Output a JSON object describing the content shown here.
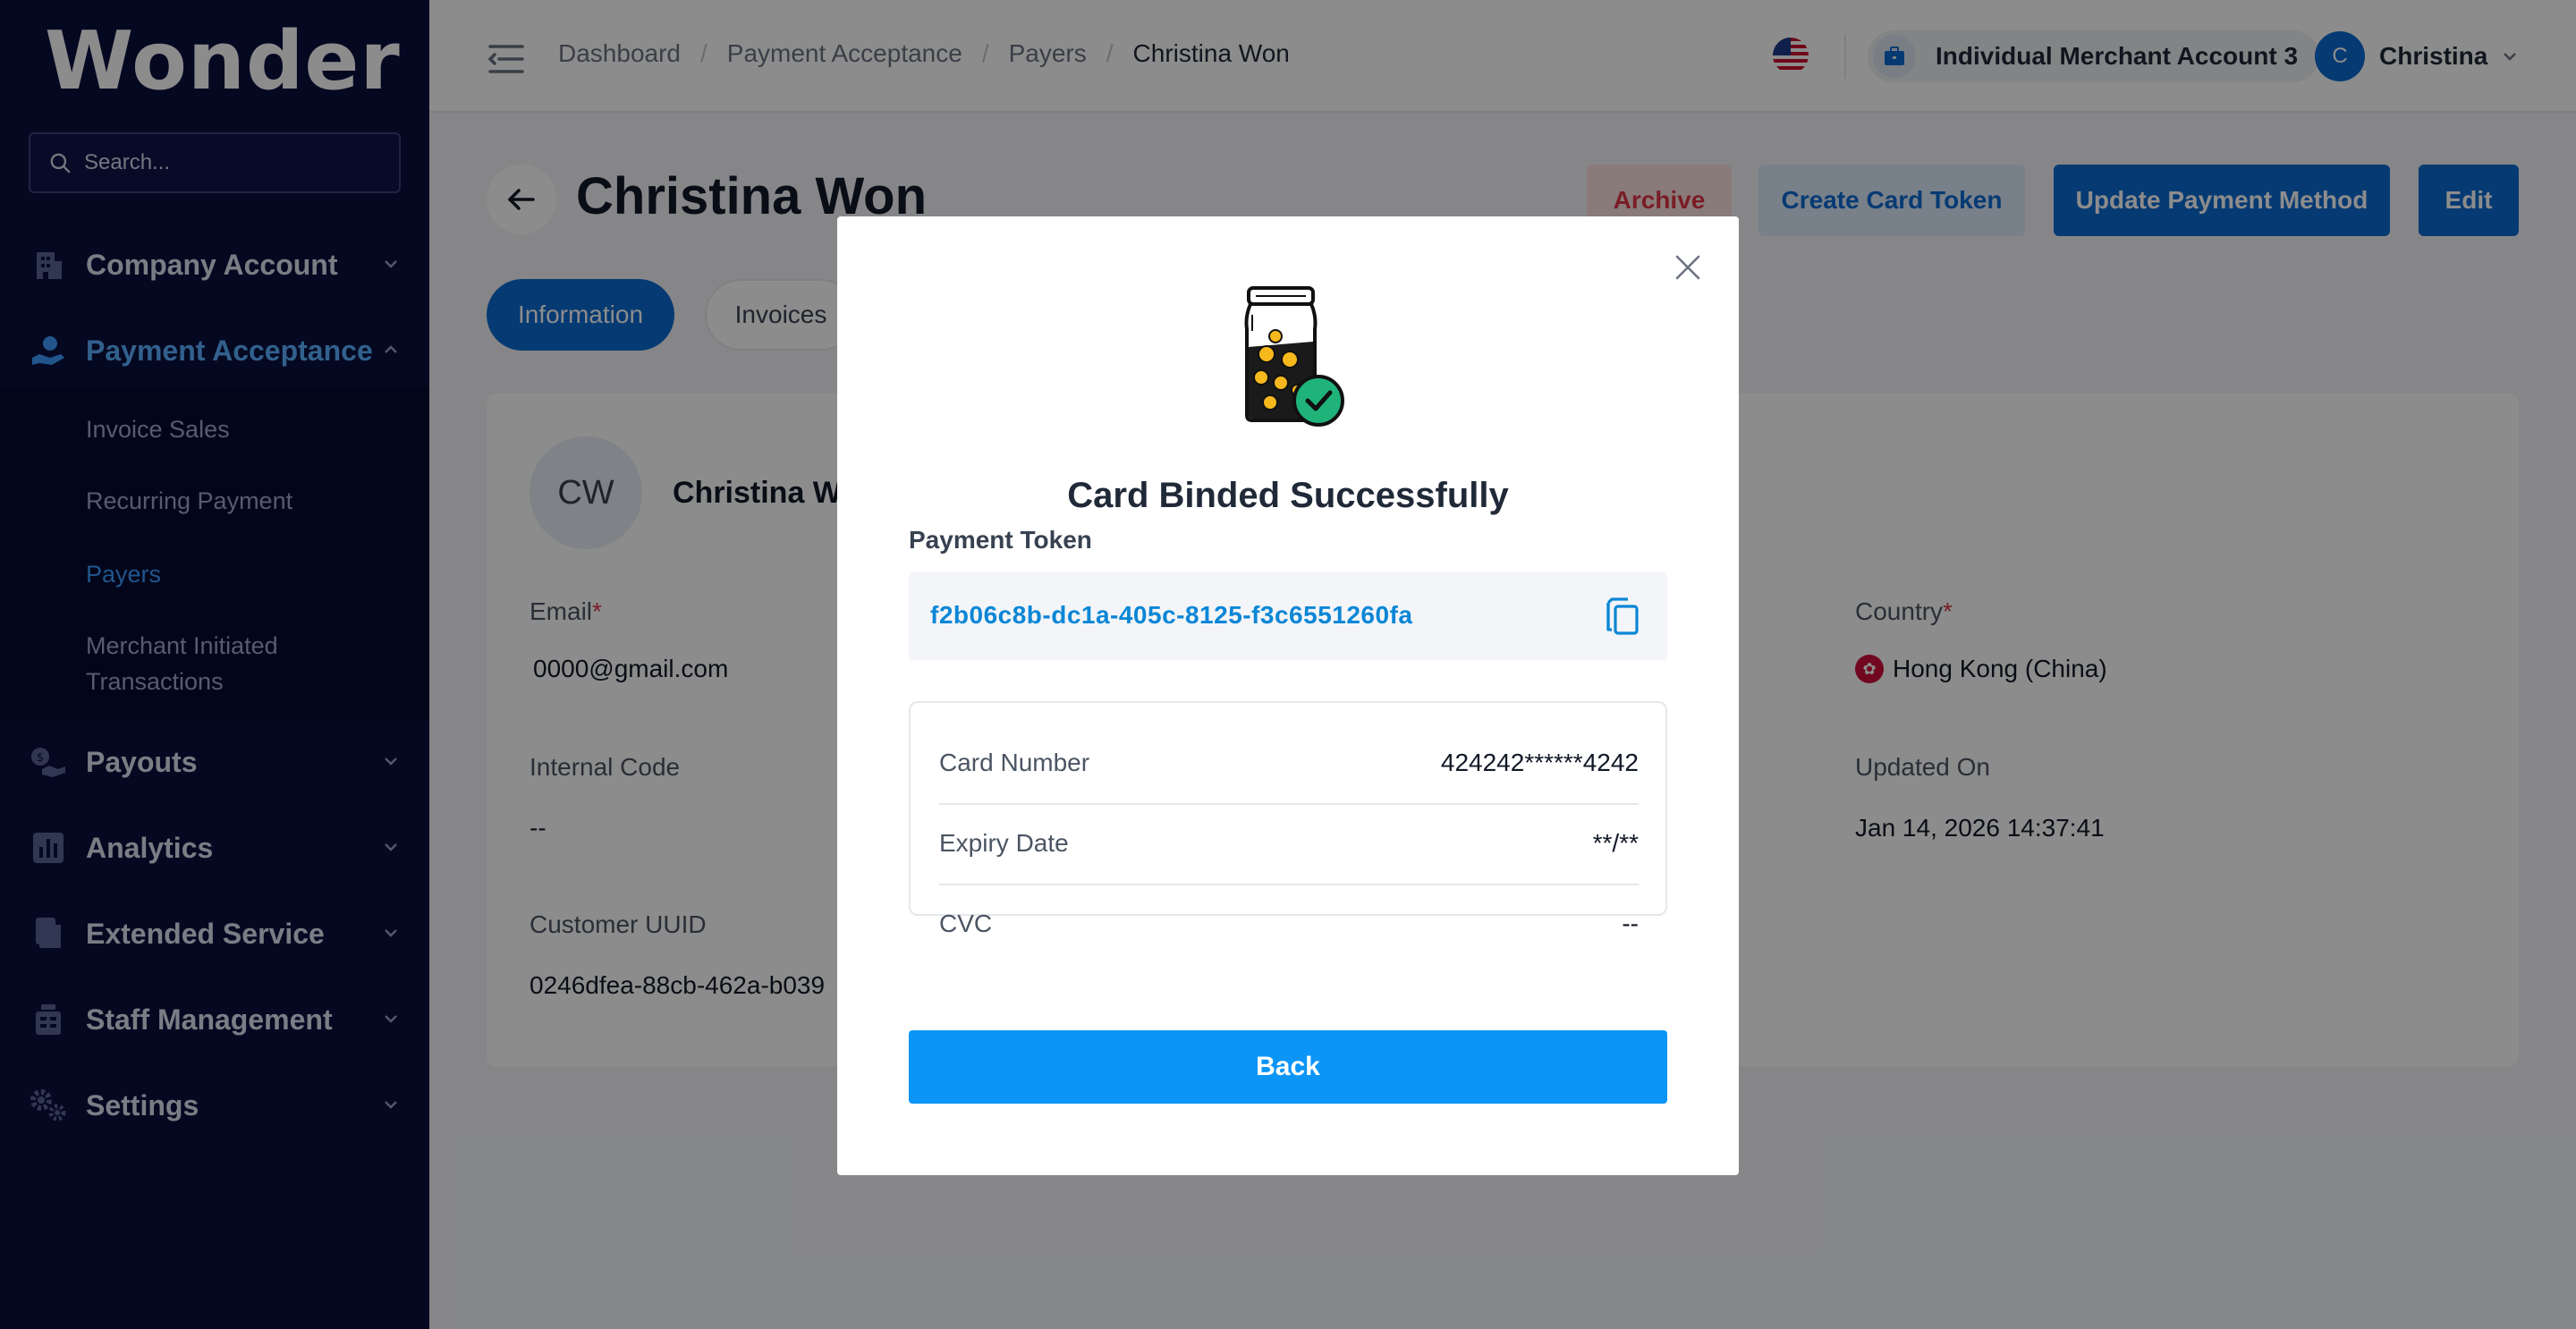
{
  "sidebar": {
    "logo": "Wonder",
    "search_placeholder": "Search...",
    "items": [
      {
        "label": "Company Account",
        "icon": "building-icon"
      },
      {
        "label": "Payment Acceptance",
        "icon": "hand-coin-icon",
        "expanded": true
      },
      {
        "label": "Payouts",
        "icon": "payout-icon"
      },
      {
        "label": "Analytics",
        "icon": "analytics-icon"
      },
      {
        "label": "Extended Service",
        "icon": "extended-service-icon"
      },
      {
        "label": "Staff Management",
        "icon": "staff-icon"
      },
      {
        "label": "Settings",
        "icon": "settings-icon"
      }
    ],
    "sub_items": [
      "Invoice Sales",
      "Recurring Payment",
      "Payers",
      "Merchant Initiated Transactions"
    ],
    "active_sub": "Payers"
  },
  "topbar": {
    "breadcrumbs": [
      "Dashboard",
      "Payment Acceptance",
      "Payers",
      "Christina Won"
    ],
    "separator": "/",
    "merchant": "Individual Merchant Account 3",
    "user_initial": "C",
    "user_name": "Christina"
  },
  "page": {
    "title": "Christina Won",
    "buttons": {
      "archive": "Archive",
      "create_token": "Create Card Token",
      "update_payment": "Update Payment Method",
      "edit": "Edit"
    },
    "tabs": [
      "Information",
      "Invoices"
    ]
  },
  "info_card": {
    "initials": "CW",
    "name": "Christina W",
    "email_label": "Email",
    "email_value": "0000@gmail.com",
    "country_label": "Country",
    "country_value": "Hong Kong (China)",
    "internal_code_label": "Internal Code",
    "internal_code_value": "--",
    "updated_label": "Updated On",
    "updated_value": "Jan 14, 2026 14:37:41",
    "uuid_label": "Customer UUID",
    "uuid_value": "0246dfea-88cb-462a-b039",
    "required_mark": "*"
  },
  "modal": {
    "title": "Card Binded Successfully",
    "token_label": "Payment Token",
    "token_value": "f2b06c8b-dc1a-405c-8125-f3c6551260fa",
    "rows": [
      {
        "label": "Card Number",
        "value": "424242******4242"
      },
      {
        "label": "Expiry Date",
        "value": "**/**"
      },
      {
        "label": "CVC",
        "value": "--"
      }
    ],
    "back_label": "Back"
  },
  "colors": {
    "sidebar_bg": "#0a0f3d",
    "primary": "#0b6ad1",
    "back_button": "#0b95f7",
    "token_text": "#0b86d6",
    "archive_text": "#dc3545",
    "success_badge": "#1fb37a"
  }
}
